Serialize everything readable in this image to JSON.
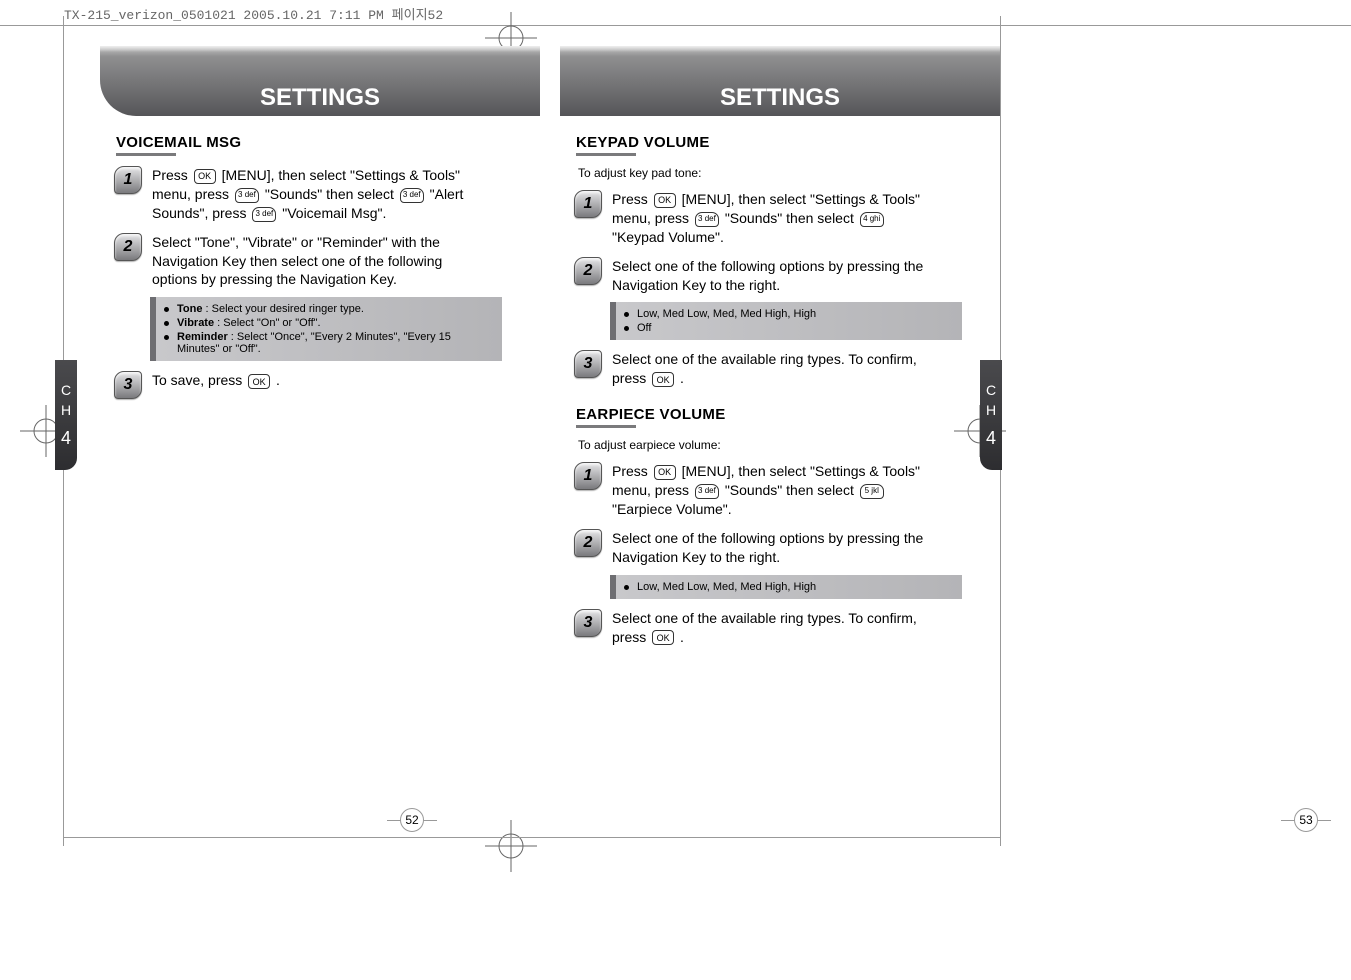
{
  "doc_header": "TX-215_verizon_0501021  2005.10.21  7:11 PM  페이지52",
  "chapter_tab": {
    "line1": "C",
    "line2": "H",
    "num": "4"
  },
  "left": {
    "header": "SETTINGS",
    "page_num": "52",
    "section_title": "VOICEMAIL MSG",
    "steps": [
      {
        "n": "1",
        "parts": [
          {
            "t": "text",
            "v": "Press "
          },
          {
            "t": "ok"
          },
          {
            "t": "text",
            "v": " [MENU], then select \"Settings & Tools\" menu, press "
          },
          {
            "t": "num",
            "v": "3 def"
          },
          {
            "t": "text",
            "v": " \"Sounds\" then select "
          },
          {
            "t": "num",
            "v": "3 def"
          },
          {
            "t": "text",
            "v": " \"Alert Sounds\", press "
          },
          {
            "t": "num",
            "v": "3 def"
          },
          {
            "t": "text",
            "v": " \"Voicemail Msg\"."
          }
        ]
      },
      {
        "n": "2",
        "parts": [
          {
            "t": "text",
            "v": "Select \"Tone\", \"Vibrate\" or \"Reminder\" with the Navigation Key then select one of the following options by pressing the Navigation Key."
          }
        ],
        "notes": [
          {
            "bold": "Tone",
            "rest": " : Select your desired ringer type."
          },
          {
            "bold": "Vibrate",
            "rest": " : Select \"On\" or \"Off\"."
          },
          {
            "bold": "Reminder",
            "rest": " : Select \"Once\", \"Every 2 Minutes\", \"Every 15 Minutes\" or \"Off\"."
          }
        ]
      },
      {
        "n": "3",
        "parts": [
          {
            "t": "text",
            "v": "To save, press "
          },
          {
            "t": "ok"
          },
          {
            "t": "text",
            "v": " ."
          }
        ]
      }
    ]
  },
  "right": {
    "header": "SETTINGS",
    "page_num": "53",
    "sections": [
      {
        "title": "KEYPAD VOLUME",
        "intro": "To adjust key pad tone:",
        "steps": [
          {
            "n": "1",
            "parts": [
              {
                "t": "text",
                "v": "Press "
              },
              {
                "t": "ok"
              },
              {
                "t": "text",
                "v": " [MENU], then select \"Settings & Tools\" menu, press "
              },
              {
                "t": "num",
                "v": "3 def"
              },
              {
                "t": "text",
                "v": " \"Sounds\" then select "
              },
              {
                "t": "num",
                "v": "4 ghi"
              },
              {
                "t": "text",
                "v": " \"Keypad Volume\"."
              }
            ]
          },
          {
            "n": "2",
            "parts": [
              {
                "t": "text",
                "v": "Select one of the following options by pressing the Navigation Key to the right."
              }
            ],
            "notes": [
              {
                "bold": "",
                "rest": "Low, Med Low, Med, Med High, High"
              },
              {
                "bold": "",
                "rest": "Off"
              }
            ]
          },
          {
            "n": "3",
            "parts": [
              {
                "t": "text",
                "v": "Select one of the available ring types. To confirm, press "
              },
              {
                "t": "ok"
              },
              {
                "t": "text",
                "v": " ."
              }
            ]
          }
        ]
      },
      {
        "title": "EARPIECE VOLUME",
        "intro": "To adjust earpiece volume:",
        "steps": [
          {
            "n": "1",
            "parts": [
              {
                "t": "text",
                "v": "Press "
              },
              {
                "t": "ok"
              },
              {
                "t": "text",
                "v": " [MENU], then select \"Settings & Tools\" menu, press "
              },
              {
                "t": "num",
                "v": "3 def"
              },
              {
                "t": "text",
                "v": " \"Sounds\" then select "
              },
              {
                "t": "num",
                "v": "5 jkl"
              },
              {
                "t": "text",
                "v": " \"Earpiece Volume\"."
              }
            ]
          },
          {
            "n": "2",
            "parts": [
              {
                "t": "text",
                "v": "Select one of the following options by pressing the Navigation Key to the right."
              }
            ],
            "notes": [
              {
                "bold": "",
                "rest": "Low, Med Low, Med, Med High, High"
              }
            ]
          },
          {
            "n": "3",
            "parts": [
              {
                "t": "text",
                "v": "Select one of the available ring types. To confirm, press "
              },
              {
                "t": "ok"
              },
              {
                "t": "text",
                "v": " ."
              }
            ]
          }
        ]
      }
    ]
  }
}
